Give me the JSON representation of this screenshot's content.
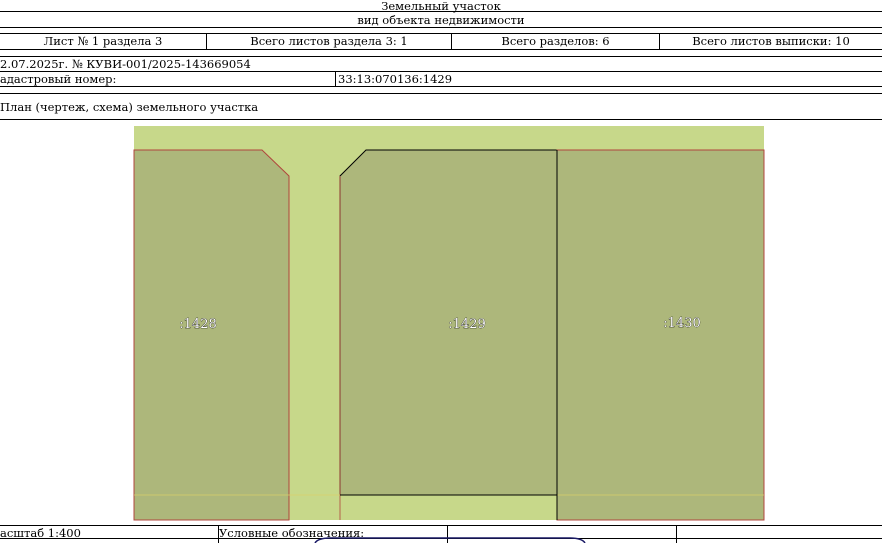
{
  "header": {
    "object_type": "Земельный участок",
    "object_kind": "вид объекта недвижимости"
  },
  "sheet_info": {
    "sheet": "Лист № 1 раздела 3",
    "total_sheets_section": "Всего листов раздела 3: 1",
    "total_sections": "Всего разделов: 6",
    "total_sheets_extract": "Всего листов выписки: 10"
  },
  "doc_ref": "2.07.2025г. № КУВИ-001/2025-143669054",
  "cadastral": {
    "label": "адастровый номер:",
    "value": "33:13:070136:1429"
  },
  "plan_title": "План (чертеж, схема) земельного участка",
  "parcels": [
    {
      "label": ":1428"
    },
    {
      "label": ":1429"
    },
    {
      "label": ":1430"
    }
  ],
  "footer": {
    "scale": "асштаб 1:400",
    "legend_label": "Условные обозначения:"
  },
  "colors": {
    "road": "#c7d88a",
    "parcel_fill": "#adb77b",
    "boundary_red": "#b0453c",
    "boundary_black": "#000000"
  }
}
